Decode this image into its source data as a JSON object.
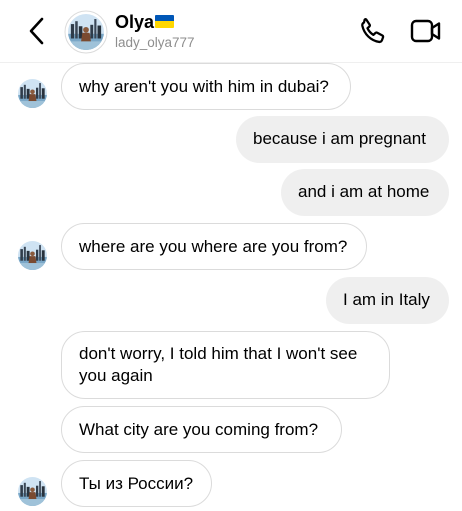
{
  "header": {
    "contact_name": "Olya",
    "username": "lady_olya777"
  },
  "icons": {
    "back": "chevron-left-icon",
    "phone": "phone-icon",
    "video": "video-camera-icon",
    "flag": "ukraine-flag-icon"
  },
  "colors": {
    "incoming_bubble_bg": "#ffffff",
    "incoming_bubble_border": "#dbdbdb",
    "outgoing_bubble_bg": "#efefef",
    "username_text": "#8e8e8e",
    "flag_blue": "#0057b7",
    "flag_yellow": "#ffd700"
  },
  "messages": [
    {
      "direction": "in",
      "text": "why aren't you with him in dubai?"
    },
    {
      "direction": "out",
      "text": "because i am pregnant"
    },
    {
      "direction": "out",
      "text": "and i am at home"
    },
    {
      "direction": "in",
      "text": "where are you where are you from?"
    },
    {
      "direction": "out",
      "text": "I am in Italy"
    },
    {
      "direction": "in",
      "text": "don't worry, I told him that I won't see you again"
    },
    {
      "direction": "in",
      "text": "What city are you coming from?"
    },
    {
      "direction": "in",
      "text": "Ты из России?"
    }
  ]
}
